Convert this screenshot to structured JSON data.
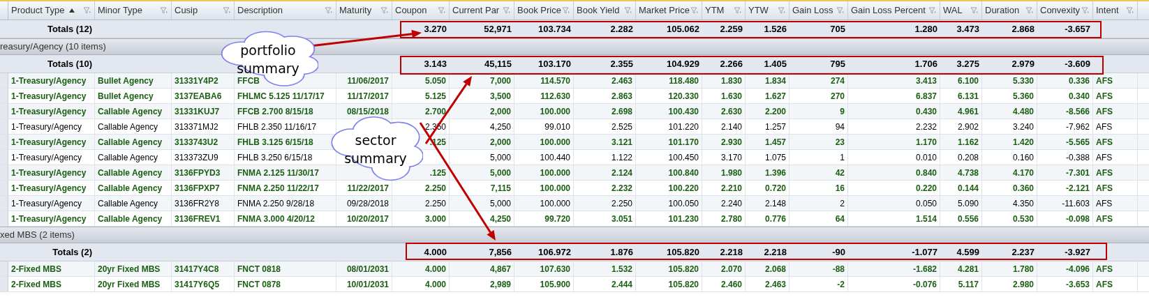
{
  "columns": [
    {
      "label": "Product Type",
      "sorted": true
    },
    {
      "label": "Minor Type",
      "sorted": false
    },
    {
      "label": "Cusip",
      "sorted": false
    },
    {
      "label": "Description",
      "sorted": false
    },
    {
      "label": "Maturity",
      "sorted": false
    },
    {
      "label": "Coupon",
      "sorted": false
    },
    {
      "label": "Current Par",
      "sorted": false
    },
    {
      "label": "Book Price",
      "sorted": false
    },
    {
      "label": "Book Yield",
      "sorted": false
    },
    {
      "label": "Market Price",
      "sorted": false
    },
    {
      "label": "YTM",
      "sorted": false
    },
    {
      "label": "YTW",
      "sorted": false
    },
    {
      "label": "Gain Loss",
      "sorted": false
    },
    {
      "label": "Gain Loss Percent",
      "sorted": false
    },
    {
      "label": "WAL",
      "sorted": false
    },
    {
      "label": "Duration",
      "sorted": false
    },
    {
      "label": "Convexity",
      "sorted": false
    },
    {
      "label": "Intent",
      "sorted": false
    }
  ],
  "rows": [
    {
      "kind": "totals",
      "label": "Totals (12)",
      "values": [
        "3.270",
        "52,971",
        "103.734",
        "2.282",
        "105.062",
        "2.259",
        "1.526",
        "705",
        "1.280",
        "3.473",
        "2.868",
        "-3.657"
      ]
    },
    {
      "kind": "group",
      "label": "reasury/Agency (10 items)"
    },
    {
      "kind": "totals",
      "label": "Totals (10)",
      "values": [
        "3.143",
        "45,115",
        "103.170",
        "2.355",
        "104.929",
        "2.266",
        "1.405",
        "795",
        "1.706",
        "3.275",
        "2.979",
        "-3.609"
      ]
    },
    {
      "kind": "data",
      "highlighted": true,
      "cells": [
        "1-Treasury/Agency",
        "Bullet Agency",
        "31331Y4P2",
        "FFCB",
        "11/06/2017",
        "5.050",
        "7,000",
        "114.570",
        "2.463",
        "118.480",
        "1.830",
        "1.834",
        "274",
        "3.413",
        "6.100",
        "5.330",
        "0.336",
        "AFS"
      ]
    },
    {
      "kind": "data",
      "highlighted": true,
      "cells": [
        "1-Treasury/Agency",
        "Bullet Agency",
        "3137EABA6",
        "FHLMC 5.125 11/17/17",
        "11/17/2017",
        "5.125",
        "3,500",
        "112.630",
        "2.863",
        "120.330",
        "1.630",
        "1.627",
        "270",
        "6.837",
        "6.131",
        "5.360",
        "0.340",
        "AFS"
      ]
    },
    {
      "kind": "data",
      "highlighted": true,
      "cells": [
        "1-Treasury/Agency",
        "Callable Agency",
        "31331KUJ7",
        "FFCB 2.700 8/15/18",
        "08/15/2018",
        "2.700",
        "2,000",
        "100.000",
        "2.698",
        "100.430",
        "2.630",
        "2.200",
        "9",
        "0.430",
        "4.961",
        "4.480",
        "-8.566",
        "AFS"
      ]
    },
    {
      "kind": "data",
      "highlighted": false,
      "cells": [
        "1-Treasury/Agency",
        "Callable Agency",
        "313371MJ2",
        "FHLB 2.350 11/16/17",
        null,
        "2.350",
        "4,250",
        "99.010",
        "2.525",
        "101.220",
        "2.140",
        "1.257",
        "94",
        "2.232",
        "2.902",
        "3.240",
        "-7.962",
        "AFS"
      ]
    },
    {
      "kind": "data",
      "highlighted": true,
      "cells": [
        "1-Treasury/Agency",
        "Callable Agency",
        "3133743U2",
        "FHLB 3.125 6/15/18",
        null,
        ".125",
        "2,000",
        "100.000",
        "3.121",
        "101.170",
        "2.930",
        "1.457",
        "23",
        "1.170",
        "1.162",
        "1.420",
        "-5.565",
        "AFS"
      ]
    },
    {
      "kind": "data",
      "highlighted": false,
      "cells": [
        "1-Treasury/Agency",
        "Callable Agency",
        "313373ZU9",
        "FHLB 3.250 6/15/18",
        null,
        null,
        "5,000",
        "100.440",
        "1.122",
        "100.450",
        "3.170",
        "1.075",
        "1",
        "0.010",
        "0.208",
        "0.160",
        "-0.388",
        "AFS"
      ]
    },
    {
      "kind": "data",
      "highlighted": true,
      "cells": [
        "1-Treasury/Agency",
        "Callable Agency",
        "3136FPYD3",
        "FNMA 2.125 11/30/17",
        null,
        ".125",
        "5,000",
        "100.000",
        "2.124",
        "100.840",
        "1.980",
        "1.396",
        "42",
        "0.840",
        "4.738",
        "4.170",
        "-7.301",
        "AFS"
      ]
    },
    {
      "kind": "data",
      "highlighted": true,
      "cells": [
        "1-Treasury/Agency",
        "Callable Agency",
        "3136FPXP7",
        "FNMA 2.250 11/22/17",
        "11/22/2017",
        "2.250",
        "7,115",
        "100.000",
        "2.232",
        "100.220",
        "2.210",
        "0.720",
        "16",
        "0.220",
        "0.144",
        "0.360",
        "-2.121",
        "AFS"
      ]
    },
    {
      "kind": "data",
      "highlighted": false,
      "cells": [
        "1-Treasury/Agency",
        "Callable Agency",
        "3136FR2Y8",
        "FNMA 2.250 9/28/18",
        "09/28/2018",
        "2.250",
        "5,000",
        "100.000",
        "2.250",
        "100.050",
        "2.240",
        "2.148",
        "2",
        "0.050",
        "5.090",
        "4.350",
        "-11.603",
        "AFS"
      ]
    },
    {
      "kind": "data",
      "highlighted": true,
      "cells": [
        "1-Treasury/Agency",
        "Callable Agency",
        "3136FREV1",
        "FNMA 3.000 4/20/12",
        "10/20/2017",
        "3.000",
        "4,250",
        "99.720",
        "3.051",
        "101.230",
        "2.780",
        "0.776",
        "64",
        "1.514",
        "0.556",
        "0.530",
        "-0.098",
        "AFS"
      ]
    },
    {
      "kind": "group",
      "label": "xed MBS (2 items)"
    },
    {
      "kind": "totals",
      "label": "Totals (2)",
      "values": [
        "4.000",
        "7,856",
        "106.972",
        "1.876",
        "105.820",
        "2.218",
        "2.218",
        "-90",
        "-1.077",
        "4.599",
        "2.237",
        "-3.927"
      ]
    },
    {
      "kind": "data",
      "highlighted": true,
      "cells": [
        "2-Fixed MBS",
        "20yr Fixed MBS",
        "31417Y4C8",
        "FNCT 0818",
        "08/01/2031",
        "4.000",
        "4,867",
        "107.630",
        "1.532",
        "105.820",
        "2.070",
        "2.068",
        "-88",
        "-1.682",
        "4.281",
        "1.780",
        "-4.096",
        "AFS"
      ]
    },
    {
      "kind": "data",
      "highlighted": true,
      "cells": [
        "2-Fixed MBS",
        "20yr Fixed MBS",
        "31417Y6Q5",
        "FNCT 0878",
        "10/01/2031",
        "4.000",
        "2,989",
        "105.900",
        "2.444",
        "105.820",
        "2.460",
        "2.463",
        "-2",
        "-0.076",
        "5.117",
        "2.980",
        "-3.653",
        "AFS"
      ]
    }
  ],
  "callouts": [
    {
      "text": "portfolio summary"
    },
    {
      "text": "sector summary"
    }
  ]
}
